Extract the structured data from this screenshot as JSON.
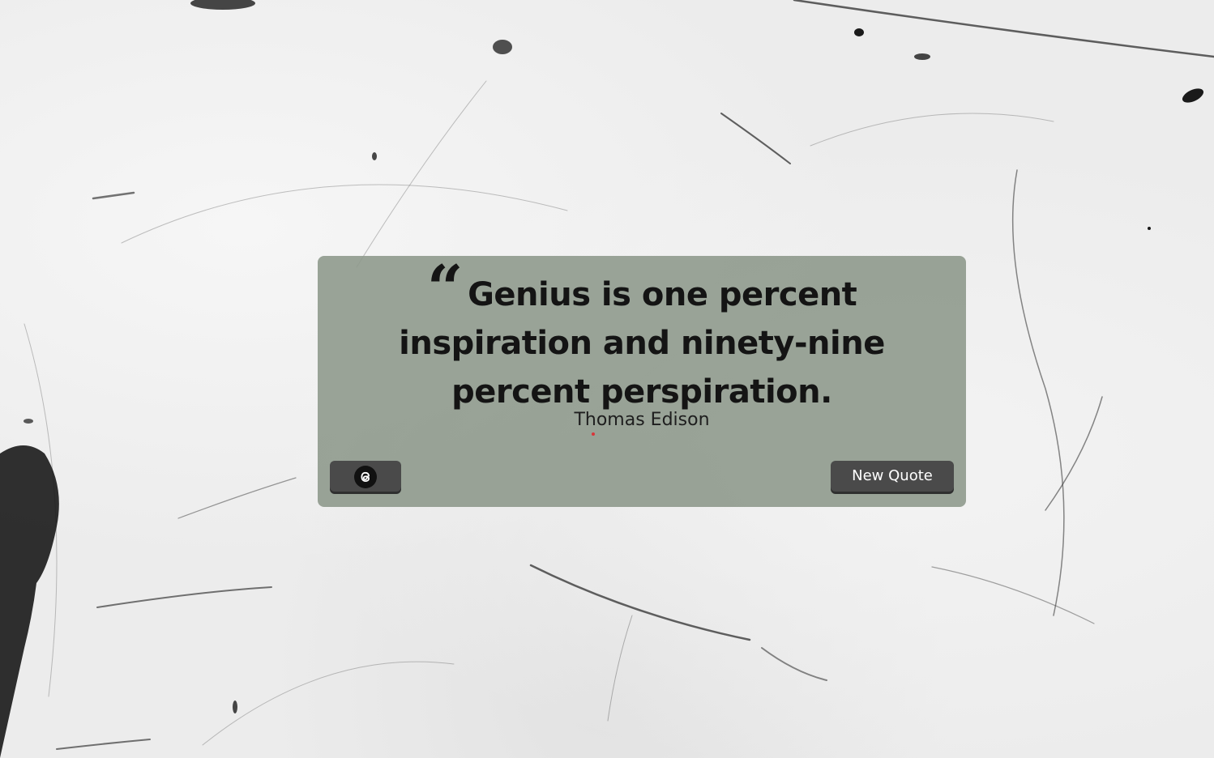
{
  "quote": {
    "mark_glyph": "“",
    "text": "Genius is one percent inspiration and ninety-nine percent perspiration.",
    "author": "Thomas Edison"
  },
  "actions": {
    "share_icon": "threads-icon",
    "new_quote_label": "New Quote"
  },
  "colors": {
    "card_background": "#8c978a",
    "button_background": "#4a4a4a",
    "text": "#141414"
  }
}
